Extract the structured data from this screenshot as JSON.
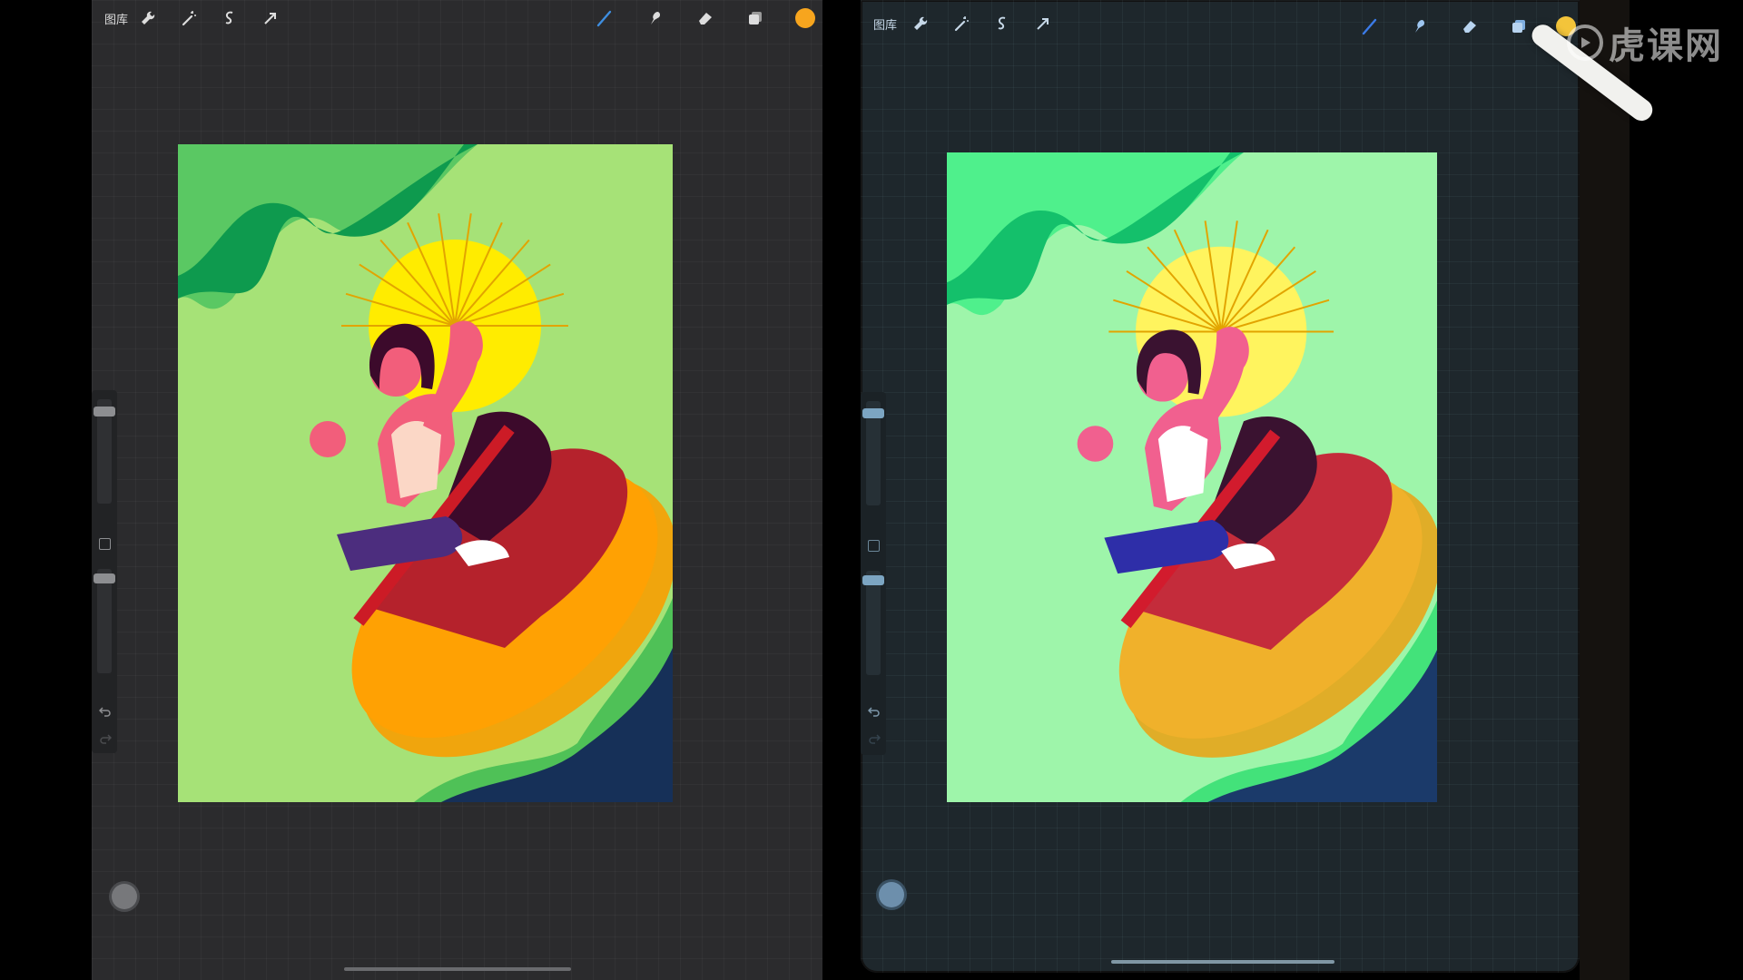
{
  "left": {
    "gallery_label": "图库",
    "color": "#f7a51e",
    "tools": [
      "wrench-icon",
      "magic-wand-icon",
      "selection-icon",
      "transform-icon",
      "brush-icon",
      "smudge-icon",
      "eraser-icon",
      "layers-icon"
    ]
  },
  "right": {
    "gallery_label": "图库",
    "color": "#f3c43a",
    "tools": [
      "wrench-icon",
      "magic-wand-icon",
      "selection-icon",
      "transform-icon",
      "brush-icon",
      "smudge-icon",
      "eraser-icon",
      "layers-icon"
    ]
  },
  "watermark": {
    "text": "虎课网"
  },
  "palette_left": {
    "bg": "#a6e277",
    "wave_dark": "#0e9a4e",
    "wave_light": "#5ac863",
    "sun": "#ffec00",
    "boat_outer": "#ffa103",
    "boat_rim": "#f0a50d",
    "boat_inner": "#b5222c",
    "hair": "#3c0a2b",
    "skin": "#f25e7b",
    "shirt": "#fbd7c6",
    "pants": "#4c2d7e",
    "shoes": "#ffffff",
    "sea": "#163058",
    "sea_edge": "#4fc157",
    "paddle": "#cc1b26"
  },
  "palette_right": {
    "bg": "#9ef5aa",
    "wave_dark": "#14c06b",
    "wave_light": "#4ff08c",
    "sun": "#fff45e",
    "boat_outer": "#f0b12b",
    "boat_rim": "#e0ad28",
    "boat_inner": "#c42c3b",
    "hair": "#3a1230",
    "skin": "#f1608f",
    "shirt": "#ffffff",
    "pants": "#2e2ea8",
    "shoes": "#ffffff",
    "sea": "#1b3a6a",
    "sea_edge": "#43e27a",
    "paddle": "#d21b2d"
  }
}
